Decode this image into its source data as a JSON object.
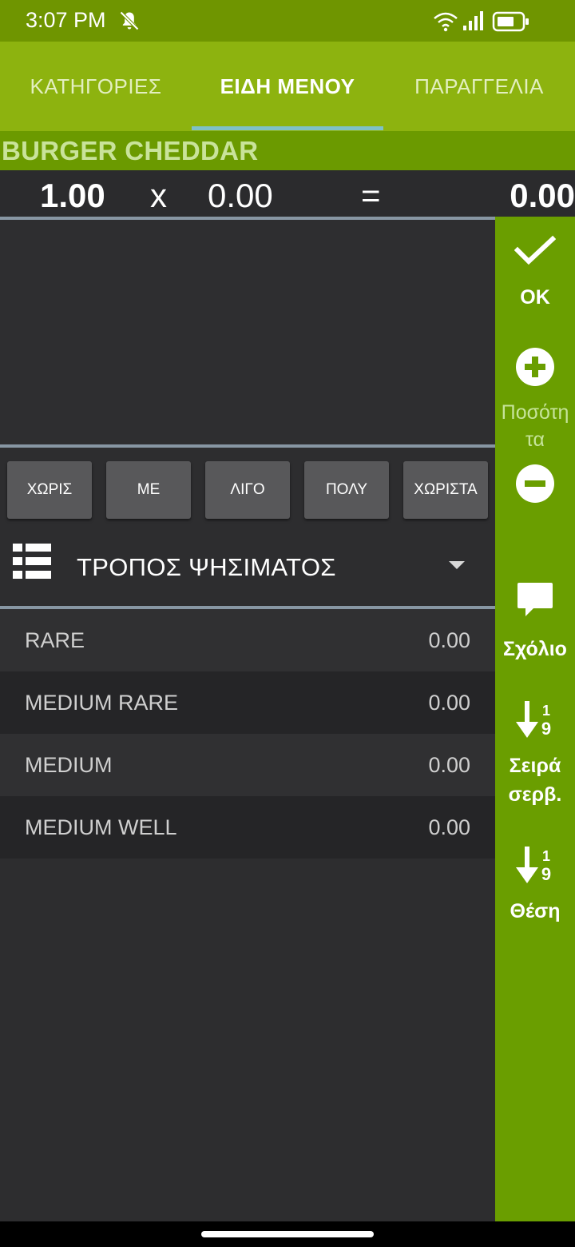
{
  "status": {
    "time": "3:07 PM",
    "icons": [
      "bell-off-icon",
      "wifi-icon",
      "signal-icon",
      "battery-icon"
    ]
  },
  "tabs": [
    {
      "label": "ΚΑΤΗΓΟΡΙΕΣ",
      "active": false
    },
    {
      "label": "ΕΙΔΗ ΜΕΝΟΥ",
      "active": true
    },
    {
      "label": "ΠΑΡΑΓΓΕΛΙΑ",
      "active": false
    }
  ],
  "item": {
    "title": "BURGER CHEDDAR",
    "quantity": "1.00",
    "times": "x",
    "price": "0.00",
    "equals": "=",
    "total": "0.00"
  },
  "modifiers": [
    "ΧΩΡΙΣ",
    "ΜΕ",
    "ΛΙΓΟ",
    "ΠΟΛΥ",
    "ΧΩΡΙΣΤΑ"
  ],
  "dropdown": {
    "label": "ΤΡΟΠΟΣ ΨΗΣΙΜΑΤΟΣ",
    "icon": "list-icon"
  },
  "options": [
    {
      "name": "RARE",
      "price": "0.00"
    },
    {
      "name": "MEDIUM RARE",
      "price": "0.00"
    },
    {
      "name": "MEDIUM",
      "price": "0.00"
    },
    {
      "name": "MEDIUM WELL",
      "price": "0.00"
    }
  ],
  "sidebar": {
    "ok_label": "OK",
    "quantity_label_line1": "Ποσότη",
    "quantity_label_line2": "τα",
    "comment_label": "Σχόλιο",
    "serve_order_line1": "Σειρά",
    "serve_order_line2": "σερβ.",
    "position_label": "Θέση",
    "sort_icon_top": "1",
    "sort_icon_bottom": "9"
  },
  "colors": {
    "status_bar": "#6f9500",
    "tab_bar": "#8db30f",
    "title_bar": "#6b9a00",
    "side_panel": "#6a9e00",
    "tab_indicator": "#7fc1c8",
    "background": "#2d2d2f"
  }
}
